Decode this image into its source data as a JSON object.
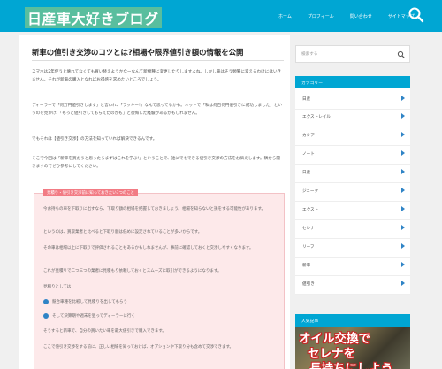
{
  "header": {
    "site_title": "日産車大好きブログ",
    "nav": [
      "ホーム",
      "プロフィール",
      "問い合わせ",
      "サイトマップ"
    ]
  },
  "article": {
    "title": "新車の値引き交渉のコツとは?相場や限界値引き額の情報を公開",
    "paragraphs": [
      "スマホは2年使うと壊れてなくても買い替えようかなーなんて新機種に変更したりしますよね。しかし車はそう頻繁に変えるわけにはいきません。それが新車の購入となればお得感を求めたいところでしょう。",
      "ディーラーで「何万円値引きします」と言われ、「ラッキー!」なんて思ってるかも。ネットで「私は何百何円値引きに成功しました」というのを見かけ、「もっと値引きしてもらえたのかも」と後悔した経験があるかもしれません。",
      "でもそれは【値引き交渉】の方法を知っていれば解決できるんです。",
      "そこで今回は「新車を買おうと思ったらまずはこれを学ぶ!」ということで、誰にでもできる値引き交渉の方法をお伝えします。隣から聞きますのでぜひ参考にしてください。"
    ]
  },
  "box": {
    "label": "見積り・値引き交渉前に知っておきたい3つのこと",
    "lines": [
      "今お持ちの車を下取りに出すなら、下取り額の相場を把握しておきましょう。相場を知らないと損をする可能性があります。",
      "というのは、買取業者と比べると下取り額は低めに設定されていることが多いからです。",
      "その車は相場以上に下取りで評価されることもあるかもしれませんが、事前に確認しておくと交渉しやすくなります。",
      "これが見積りで二つ三つの業者に見積もり依頼しておくとスムーズに取引ができるようになります。",
      "見積りとしては"
    ],
    "checks": [
      "競合車種を比較して見積りを出してもらう",
      "そして決算期や週末を狙ってディーラーに行く"
    ],
    "after_lines": [
      "そうすると新車で、自分の買いたい車を最大値引きで購入できます。",
      "ここで値引き交渉をする前に、正しい相場を知っておけば、オプションや下取り分も含めて交渉できます。"
    ]
  },
  "sidebar": {
    "search_placeholder": "検索する",
    "category_title": "カテゴリー",
    "categories": [
      "日産",
      "エクストレイル",
      "カシア",
      "ノート",
      "日産",
      "ジューク",
      "エクスト",
      "セレナ",
      "リーフ",
      "新車",
      "値引き"
    ],
    "popular_title": "人気記事",
    "popular_thumb_lines": [
      "オイル交換で",
      "セレナを",
      "長持ちにしよう"
    ]
  }
}
